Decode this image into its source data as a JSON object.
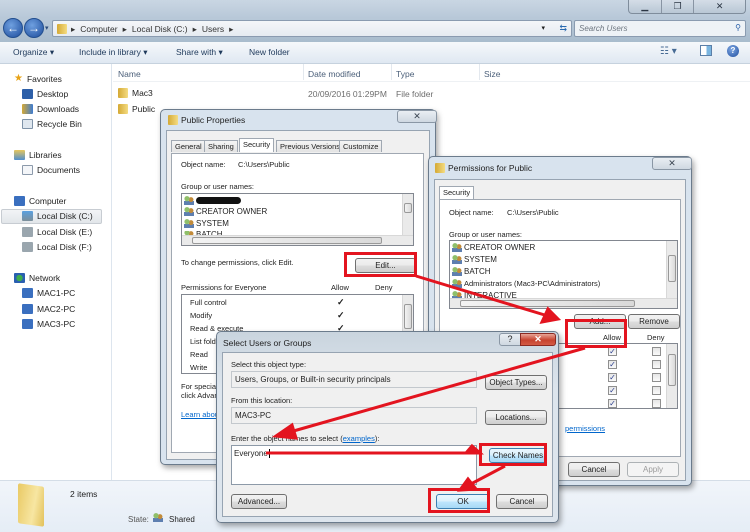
{
  "explorer": {
    "breadcrumb": [
      "Computer",
      "Local Disk (C:)",
      "Users"
    ],
    "search_placeholder": "Search Users",
    "window_controls": {
      "minimize": "▁",
      "restore": "❐",
      "close": "✕"
    },
    "toolbar": {
      "organize": "Organize ▾",
      "include_in_library": "Include in library ▾",
      "share_with": "Share with ▾",
      "new_folder": "New folder"
    },
    "sidebar": {
      "favorites": {
        "label": "Favorites",
        "items": [
          "Desktop",
          "Downloads",
          "Recycle Bin"
        ]
      },
      "libraries": {
        "label": "Libraries",
        "items": [
          "Documents"
        ]
      },
      "computer": {
        "label": "Computer",
        "items": [
          "Local Disk (C:)",
          "Local Disk (E:)",
          "Local Disk (F:)"
        ],
        "selected": "Local Disk (C:)"
      },
      "network": {
        "label": "Network",
        "items": [
          "MAC1-PC",
          "MAC2-PC",
          "MAC3-PC"
        ]
      }
    },
    "columns": [
      "Name",
      "Date modified",
      "Type",
      "Size"
    ],
    "files": [
      {
        "name": "Mac3",
        "date": "20/09/2016 01:29PM",
        "type": "File folder"
      },
      {
        "name": "Public",
        "date": "",
        "type": ""
      }
    ],
    "status": {
      "count": "2 items",
      "state_label": "State:",
      "state_value": "Shared"
    }
  },
  "public_properties": {
    "title": "Public Properties",
    "close": "✕",
    "tabs": [
      "General",
      "Sharing",
      "Security",
      "Previous Versions",
      "Customize"
    ],
    "active_tab": "Security",
    "object_name_label": "Object name:",
    "object_name": "C:\\Users\\Public",
    "group_label": "Group or user names:",
    "users": [
      "(redacted)",
      "CREATOR OWNER",
      "SYSTEM",
      "BATCH"
    ],
    "change_hint": "To change permissions, click Edit.",
    "edit_button": "Edit...",
    "permissions_label": "Permissions for Everyone",
    "allow_label": "Allow",
    "deny_label": "Deny",
    "permissions": [
      {
        "name": "Full control",
        "allow": true
      },
      {
        "name": "Modify",
        "allow": true
      },
      {
        "name": "Read & execute",
        "allow": true
      },
      {
        "name": "List folder contents",
        "allow": true
      },
      {
        "name": "Read",
        "allow": true
      },
      {
        "name": "Write",
        "allow": true
      }
    ],
    "special_hint_1": "For special permissions or advanced settings,",
    "special_hint_2": "click Advanced.",
    "learn_link": "Learn about access control and permissions"
  },
  "permissions_dialog": {
    "title": "Permissions for Public",
    "close": "✕",
    "tab": "Security",
    "object_name_label": "Object name:",
    "object_name": "C:\\Users\\Public",
    "group_label": "Group or user names:",
    "users": [
      "CREATOR OWNER",
      "SYSTEM",
      "BATCH",
      "Administrators (Mac3-PC\\Administrators)",
      "INTERACTIVE"
    ],
    "add_button": "Add...",
    "remove_button": "Remove",
    "allow_label": "Allow",
    "deny_label": "Deny",
    "perm_rows": [
      {
        "allow": true,
        "deny": false
      },
      {
        "allow": true,
        "deny": false
      },
      {
        "allow": true,
        "deny": false
      },
      {
        "allow": true,
        "deny": false
      },
      {
        "allow": true,
        "deny": false
      }
    ],
    "link_partial": "permissions",
    "cancel_button": "Cancel",
    "apply_button": "Apply"
  },
  "select_users": {
    "title": "Select Users or Groups",
    "help": "?",
    "close": "✕",
    "object_type_label": "Select this object type:",
    "object_type_value": "Users, Groups, or Built-in security principals",
    "object_types_button": "Object Types...",
    "location_label": "From this location:",
    "location_value": "MAC3-PC",
    "locations_button": "Locations...",
    "enter_label": "Enter the object names to select (",
    "examples_link": "examples",
    "enter_label_end": "):",
    "names_value": "Everyone",
    "check_names_button": "Check Names",
    "advanced_button": "Advanced...",
    "ok_button": "OK",
    "cancel_button": "Cancel"
  },
  "annotation_color": "#e3141f"
}
